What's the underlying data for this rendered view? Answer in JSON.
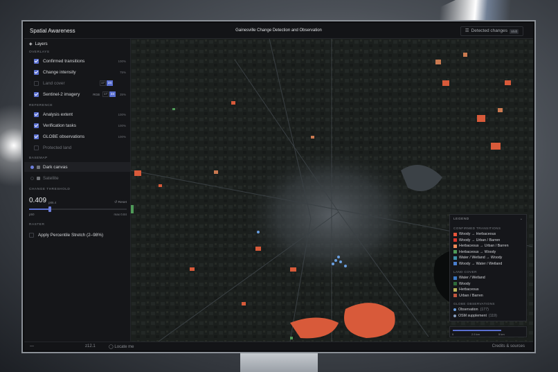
{
  "app": {
    "brand": "Spatial Awareness",
    "map_title": "Gainesville Change Detection and Observation",
    "detected_changes": {
      "label": "Detected changes",
      "shortcut": "Shift"
    }
  },
  "sidebar": {
    "header": "Layers",
    "overlays_title": "OVERLAYS",
    "overlays": [
      {
        "label": "Confirmed transitions",
        "checked": true,
        "pct": "100%"
      },
      {
        "label": "Change intensity",
        "checked": true,
        "pct": "75%"
      },
      {
        "label": "Land cover",
        "checked": false,
        "years": [
          "17",
          "24"
        ]
      },
      {
        "label": "Sentinel-2 imagery",
        "checked": true,
        "mode": "RGB",
        "years": [
          "17",
          "24"
        ],
        "pct": "35%"
      }
    ],
    "reference_title": "REFERENCE",
    "reference": [
      {
        "label": "Analysis extent",
        "checked": true,
        "pct": "100%"
      },
      {
        "label": "Verification tasks",
        "checked": true,
        "pct": "100%"
      },
      {
        "label": "GLOBE observations",
        "checked": true,
        "pct": "100%"
      },
      {
        "label": "Protected land",
        "checked": false,
        "pct": ""
      }
    ],
    "basemap_title": "BASEMAP",
    "basemaps": [
      {
        "label": "Dark canvas",
        "selected": true
      },
      {
        "label": "Satellite",
        "selected": false
      }
    ],
    "threshold_title": "CHANGE THRESHOLD",
    "threshold": {
      "value": "0.409",
      "sub": "p86.4",
      "reset": "Reset",
      "min": "p50",
      "max": "max 0.84",
      "fraction": 0.21
    },
    "raster_title": "RASTER",
    "raster_option": "Apply Percentile Stretch (2–98%)"
  },
  "legend": {
    "title": "LEGEND",
    "transitions_title": "CONFIRMED TRANSITIONS",
    "transitions": [
      {
        "label": "Woody → Herbaceous",
        "color": "#e8553a"
      },
      {
        "label": "Woody → Urban / Barren",
        "color": "#d9342b"
      },
      {
        "label": "Herbaceous → Urban / Barren",
        "color": "#f08a5a"
      },
      {
        "label": "Herbaceous → Woody",
        "color": "#4f9a58"
      },
      {
        "label": "Water / Wetland → Woody",
        "color": "#3f8fa8"
      },
      {
        "label": "Woody → Water / Wetland",
        "color": "#4a7fd0"
      }
    ],
    "landcover_title": "LAND COVER",
    "landcover": [
      {
        "label": "Water / Wetland",
        "color": "#3b78c4"
      },
      {
        "label": "Woody",
        "color": "#2f6b3a"
      },
      {
        "label": "Herbaceous",
        "color": "#b9b45a"
      },
      {
        "label": "Urban / Barren",
        "color": "#c1553e"
      }
    ],
    "globe_title": "GLOBE OBSERVATIONS",
    "globe": [
      {
        "label": "Observation",
        "count": "(177)",
        "color": "#6a9fe0"
      },
      {
        "label": "OSM supplement",
        "count": "(119)",
        "color": "#8aa0c0"
      }
    ]
  },
  "scale": {
    "start": "0",
    "mid": "2.5 km",
    "end": "5 km"
  },
  "bottom": {
    "collapse": "—",
    "zoom": "z12.1",
    "locate": "Locate me",
    "credits": "Credits & sources"
  }
}
